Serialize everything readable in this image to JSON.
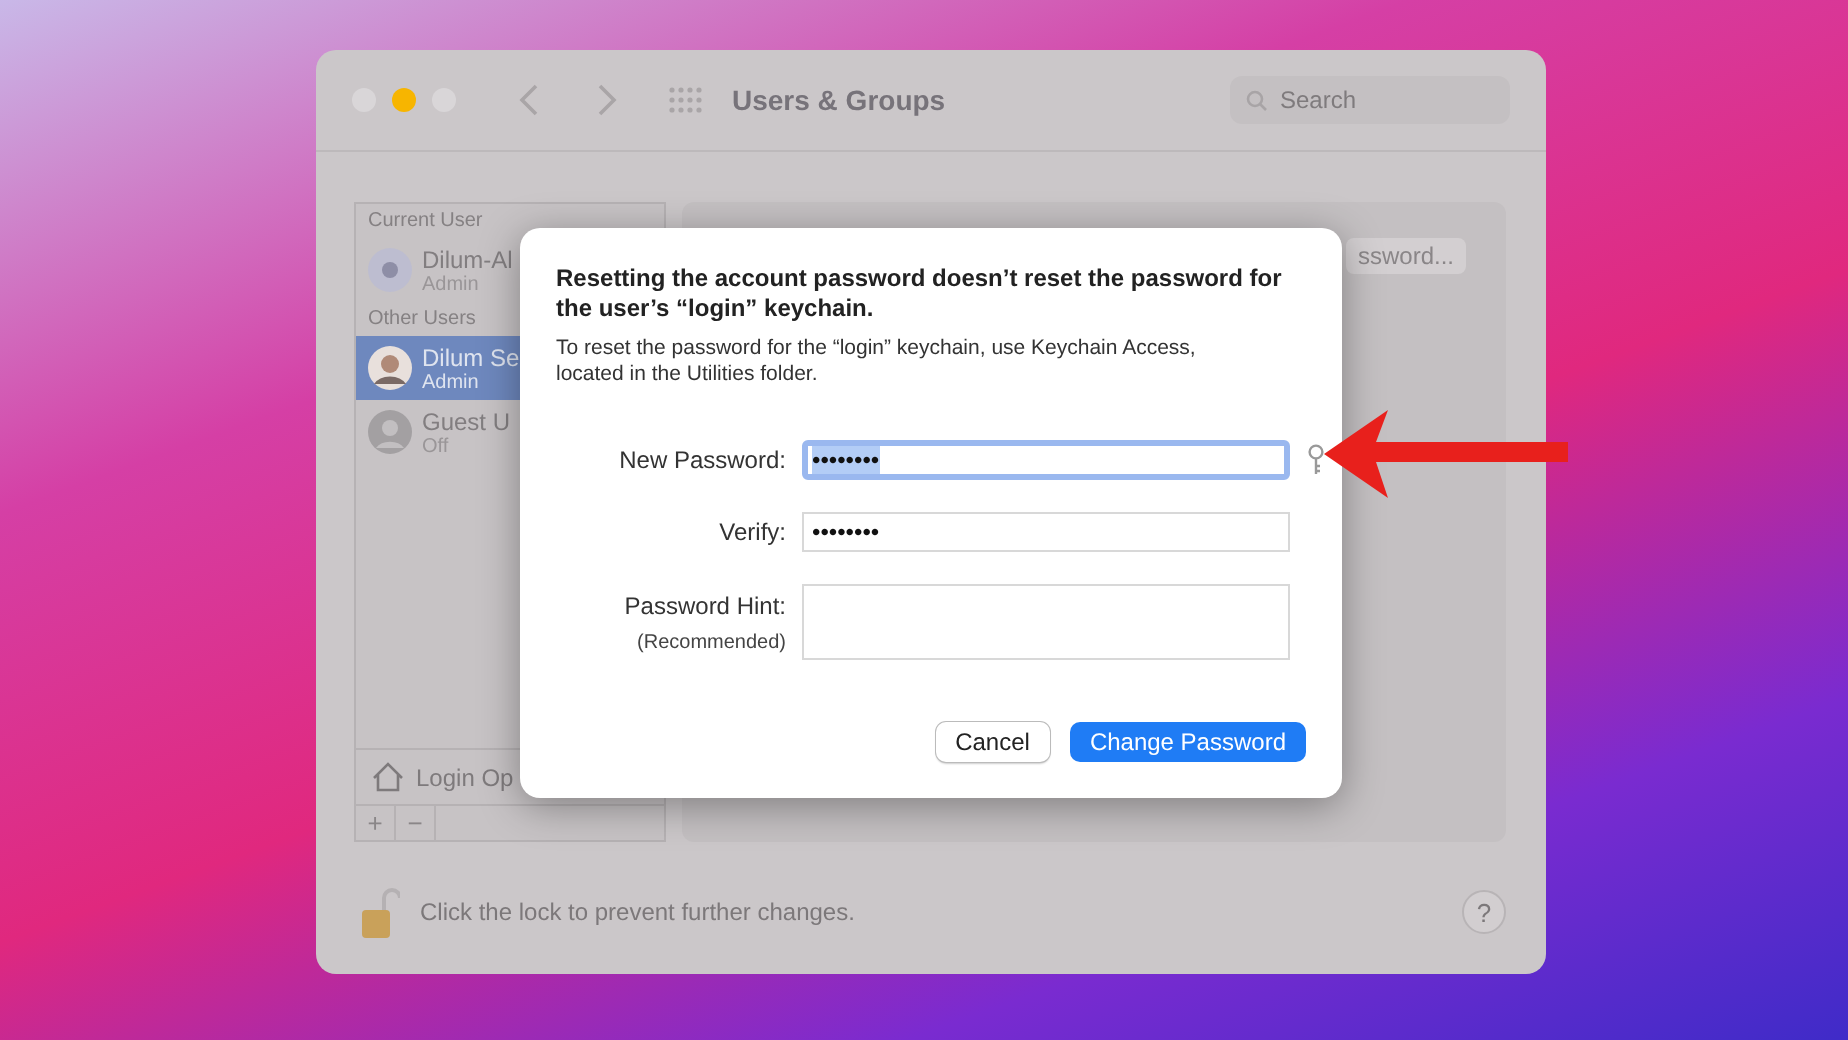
{
  "window": {
    "title": "Users & Groups",
    "search": {
      "placeholder": "Search"
    }
  },
  "sidebar": {
    "sections": [
      {
        "header": "Current User",
        "users": [
          {
            "name": "Dilum-Al",
            "role": "Admin",
            "kind": "gear",
            "selected": false
          }
        ]
      },
      {
        "header": "Other Users",
        "users": [
          {
            "name": "Dilum Se",
            "role": "Admin",
            "kind": "photo",
            "selected": true
          },
          {
            "name": "Guest U",
            "role": "Off",
            "kind": "person",
            "selected": false
          }
        ]
      }
    ],
    "login_options": "Login Op",
    "add": "+",
    "remove": "−"
  },
  "panel": {
    "button": "ssword..."
  },
  "status_bar": {
    "text": "Click the lock to prevent further changes.",
    "help": "?"
  },
  "dialog": {
    "title": "Resetting the account password doesn’t reset the password for the user’s “login” keychain.",
    "message": "To reset the password for the “login” keychain, use Keychain Access, located in the Utilities folder.",
    "fields": [
      {
        "label": "New Password:",
        "value": "••••••••",
        "focused": true,
        "kind": "password"
      },
      {
        "label": "Verify:",
        "value": "••••••••",
        "focused": false,
        "kind": "password"
      },
      {
        "label": "Password Hint:",
        "sublabel": "(Recommended)",
        "focused": false,
        "kind": "area"
      }
    ],
    "buttons": [
      {
        "label": "Cancel",
        "default": false
      },
      {
        "label": "Change Password",
        "default": true
      }
    ]
  }
}
